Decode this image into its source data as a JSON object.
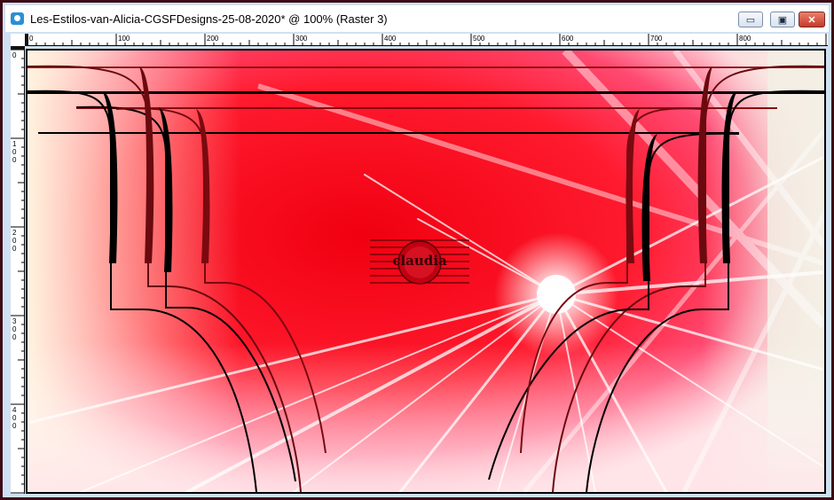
{
  "window": {
    "title": "Les-Estilos-van-Alicia-CGSFDesigns-25-08-2020* @ 100% (Raster 3)",
    "border_color": "#3b0a14"
  },
  "controls": {
    "minimize_icon": "minimize-icon",
    "maximize_icon": "maximize-icon",
    "close_icon": "close-icon",
    "minimize_glyph": "▭",
    "maximize_glyph": "▣",
    "close_glyph": "✕"
  },
  "ruler": {
    "top_labels": [
      "0",
      "100",
      "200",
      "300",
      "400",
      "500",
      "600",
      "700",
      "800"
    ],
    "left_labels": [
      "0",
      "1\n0\n0",
      "2\n0\n0",
      "3\n0\n0",
      "4\n0\n0"
    ]
  },
  "canvas": {
    "layer": "Raster 3",
    "watermark_text": "claudia",
    "colors": {
      "red": "#ff1020",
      "pink": "#ff3a66",
      "cream": "#fff0dc",
      "line_dark": "#000000",
      "line_maroon": "#8a0a10"
    }
  }
}
